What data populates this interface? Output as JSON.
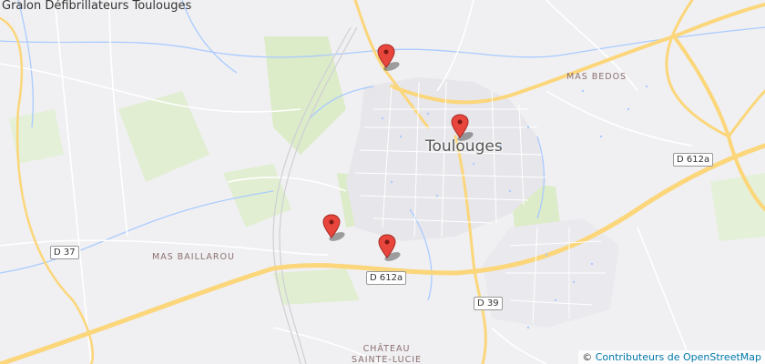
{
  "map": {
    "title": "Gralon Défibrillateurs Toulouges",
    "town_label": "Toulouges",
    "localities": [
      {
        "name": "mas-bedos",
        "label": "MAS BEDOS"
      },
      {
        "name": "mas-baillarou",
        "label": "MAS BAILLAROU"
      },
      {
        "name": "chateau-sainte-lucie",
        "label_line1": "CHÂTEAU",
        "label_line2": "SAINTE-LUCIE"
      }
    ],
    "roads": [
      {
        "name": "d612a-east",
        "label": "D 612a"
      },
      {
        "name": "d612a-south",
        "label": "D 612a"
      },
      {
        "name": "d37",
        "label": "D 37"
      },
      {
        "name": "d39",
        "label": "D 39"
      }
    ],
    "markers_count_label": "",
    "attribution": {
      "symbol": "©",
      "link_text": "Contributeurs de OpenStreetMap"
    },
    "colors": {
      "background": "#f0f0f2",
      "major_road": "#fbd67a",
      "minor_road": "#ffffff",
      "water": "#aacbff",
      "park": "#dcebc8",
      "marker": "#e8453c"
    },
    "icons": [
      "map-marker-icon"
    ]
  }
}
